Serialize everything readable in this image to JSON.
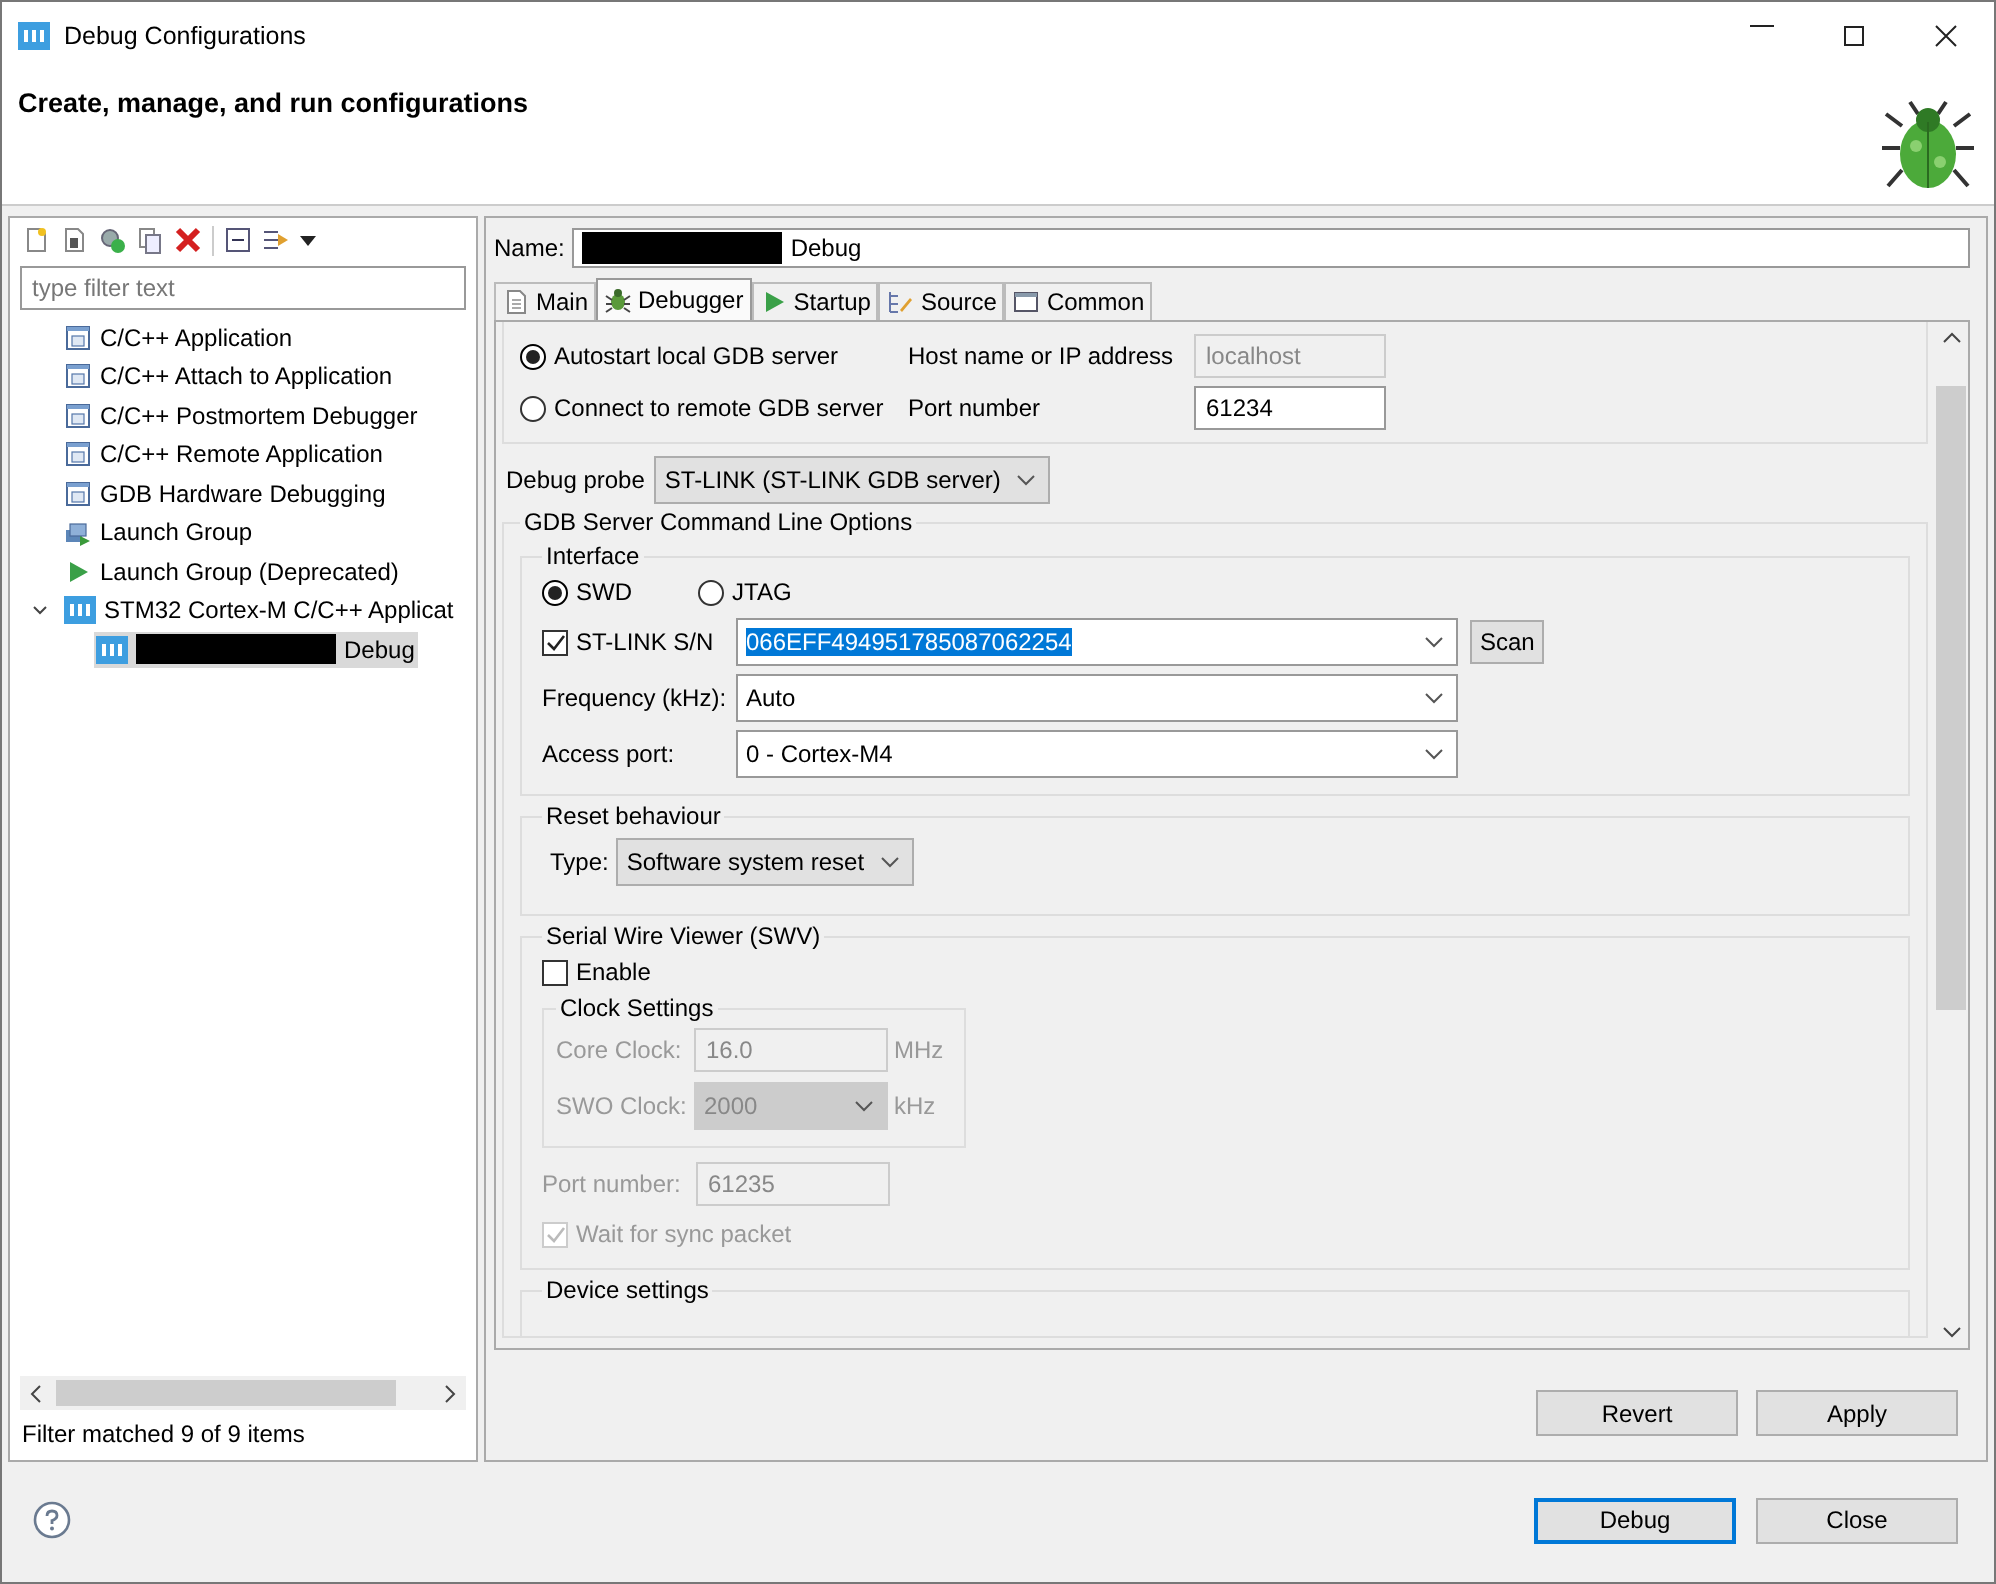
{
  "window": {
    "title": "Debug Configurations"
  },
  "header": {
    "title": "Create, manage, and run configurations"
  },
  "filter": {
    "placeholder": "type filter text"
  },
  "tree": [
    {
      "label": "C/C++ Application",
      "kind": "c",
      "selected": false
    },
    {
      "label": "C/C++ Attach to Application",
      "kind": "c",
      "selected": false
    },
    {
      "label": "C/C++ Postmortem Debugger",
      "kind": "c",
      "selected": false
    },
    {
      "label": "C/C++ Remote Application",
      "kind": "c",
      "selected": false
    },
    {
      "label": "GDB Hardware Debugging",
      "kind": "c",
      "selected": false
    },
    {
      "label": "Launch Group",
      "kind": "group",
      "selected": false
    },
    {
      "label": "Launch Group (Deprecated)",
      "kind": "play",
      "selected": false
    },
    {
      "label": "STM32 Cortex-M C/C++ Applicat",
      "kind": "ide",
      "selected": false,
      "expanded": true,
      "children": [
        {
          "label": "Debug",
          "kind": "ide",
          "selected": true,
          "redacted": true
        }
      ]
    }
  ],
  "filter_status": "Filter matched 9 of 9 items",
  "name_field": {
    "label": "Name:",
    "value": "Debug",
    "redacted": true
  },
  "tabs": [
    {
      "label": "Main",
      "kind": "document",
      "selected": false
    },
    {
      "label": "Debugger",
      "kind": "bug",
      "selected": true
    },
    {
      "label": "Startup",
      "kind": "play",
      "selected": false
    },
    {
      "label": "Source",
      "kind": "source",
      "selected": false
    },
    {
      "label": "Common",
      "kind": "window",
      "selected": false
    }
  ],
  "connection": {
    "radios": [
      {
        "label": "Autostart local GDB server",
        "selected": true
      },
      {
        "label": "Connect to remote GDB server",
        "selected": false
      }
    ],
    "host_label": "Host name or IP address",
    "host_value": "localhost",
    "host_disabled": true,
    "port_label": "Port number",
    "port_value": "61234"
  },
  "debug_probe": {
    "label": "Debug probe",
    "value": "ST-LINK (ST-LINK GDB server)"
  },
  "gdb_options": {
    "title": "GDB Server Command Line Options",
    "interface": {
      "title": "Interface",
      "radios": [
        {
          "label": "SWD",
          "selected": true
        },
        {
          "label": "JTAG",
          "selected": false
        }
      ],
      "serial": {
        "label": "ST-LINK S/N",
        "checked": true,
        "value": "066EFF494951785087062254",
        "highlighted": true
      },
      "scan_button": "Scan",
      "frequency": {
        "label": "Frequency (kHz):",
        "value": "Auto"
      },
      "access_port": {
        "label": "Access port:",
        "value": "0 - Cortex-M4"
      }
    },
    "reset": {
      "title": "Reset behaviour",
      "type_label": "Type:",
      "type_value": "Software system reset"
    },
    "swv": {
      "title": "Serial Wire Viewer (SWV)",
      "enable": {
        "label": "Enable",
        "checked": false
      },
      "clock": {
        "title": "Clock Settings",
        "core": {
          "label": "Core Clock:",
          "value": "16.0",
          "unit": "MHz",
          "disabled": true
        },
        "swo": {
          "label": "SWO Clock:",
          "value": "2000",
          "unit": "kHz",
          "disabled": true
        }
      },
      "port": {
        "label": "Port number:",
        "value": "61235",
        "disabled": true
      },
      "wait": {
        "label": "Wait for sync packet",
        "checked": true,
        "disabled": true
      }
    },
    "device_settings": {
      "title": "Device settings"
    }
  },
  "action_buttons": [
    {
      "label": "Revert",
      "default": false
    },
    {
      "label": "Apply",
      "default": false
    }
  ],
  "dialog_buttons": [
    {
      "label": "Debug",
      "default": true
    },
    {
      "label": "Close",
      "default": false
    }
  ]
}
